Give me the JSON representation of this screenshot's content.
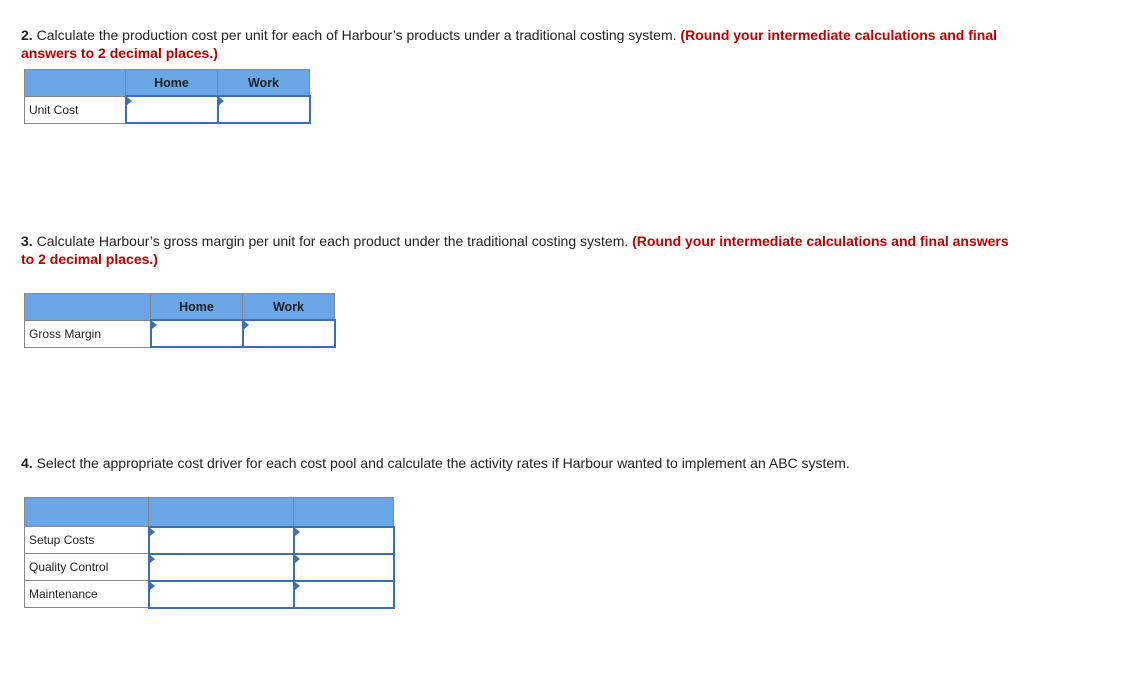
{
  "q2": {
    "num": "2.",
    "text": " Calculate the production cost per unit for each of Harbour’s products under a traditional costing system. ",
    "note": "(Round your intermediate calculations and final answers to 2 decimal places.)",
    "table": {
      "headers": [
        "",
        "Home",
        "Work"
      ],
      "rows": [
        {
          "label": "Unit Cost",
          "values": [
            "",
            ""
          ]
        }
      ]
    }
  },
  "q3": {
    "num": "3.",
    "text": " Calculate Harbour’s gross margin per unit for each product under the traditional costing system. ",
    "note": "(Round your intermediate calculations and final answers to 2 decimal places.)",
    "table": {
      "headers": [
        "",
        "Home",
        "Work"
      ],
      "rows": [
        {
          "label": "Gross Margin",
          "values": [
            "",
            ""
          ]
        }
      ]
    }
  },
  "q4": {
    "num": "4.",
    "text": " Select the appropriate cost driver for each cost pool and calculate the activity rates if Harbour wanted to implement an ABC system.",
    "table": {
      "headers": [
        "",
        "",
        ""
      ],
      "rows": [
        {
          "label": "Setup Costs",
          "values": [
            "",
            ""
          ]
        },
        {
          "label": "Quality Control",
          "values": [
            "",
            ""
          ]
        },
        {
          "label": "Maintenance",
          "values": [
            "",
            ""
          ]
        }
      ]
    }
  }
}
